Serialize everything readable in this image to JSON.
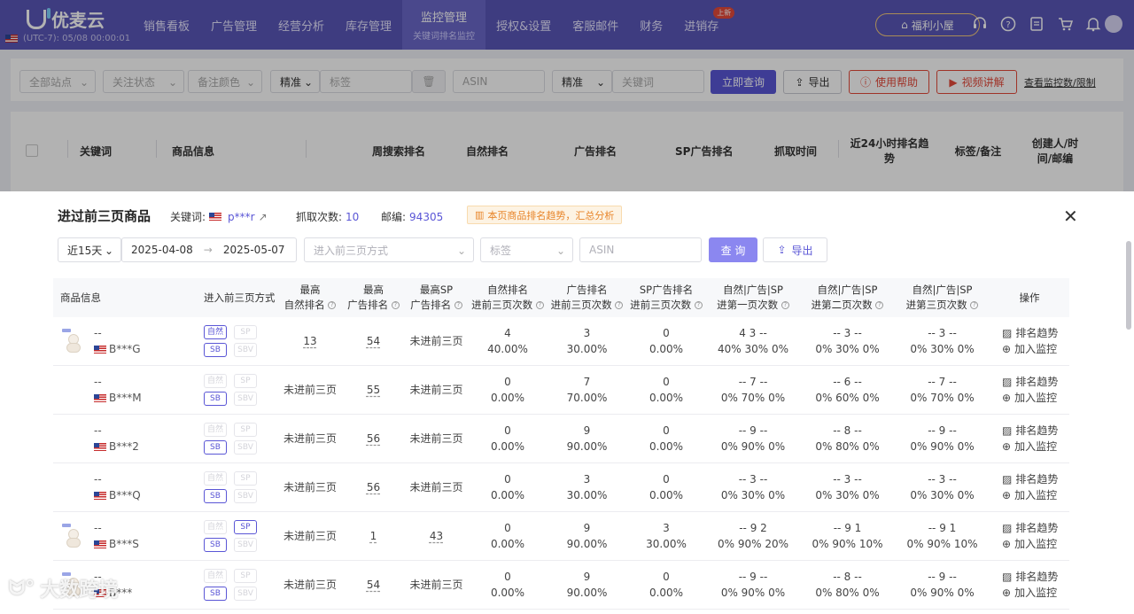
{
  "header": {
    "logo": "优麦云",
    "tz": "(UTC-7): 05/08 00:00:01",
    "nav": [
      {
        "label": "销售看板"
      },
      {
        "label": "广告管理"
      },
      {
        "label": "经营分析"
      },
      {
        "label": "库存管理"
      },
      {
        "label": "监控管理",
        "sub": "关键词排名监控",
        "active": true
      },
      {
        "label": "授权&设置"
      },
      {
        "label": "客服邮件"
      },
      {
        "label": "财务"
      },
      {
        "label": "进销存",
        "badge": "上新"
      }
    ],
    "fuli": "福利小屋",
    "icons": [
      "headset-icon",
      "help-icon",
      "doc-icon",
      "cart-icon",
      "bell-icon",
      "avatar"
    ]
  },
  "filters": {
    "site": "全部站点",
    "follow": "关注状态",
    "color": "备注颜色",
    "precise1": "精准",
    "tag": "标签",
    "asin": "ASIN",
    "precise2": "精准",
    "keyword": "关键词",
    "query": "立即查询",
    "export": "导出",
    "help": "使用帮助",
    "video": "视频讲解",
    "link": "查看监控数/限制"
  },
  "main_table": {
    "headers": [
      "关键词",
      "商品信息",
      "周搜索排名",
      "自然排名",
      "广告排名",
      "SP广告排名",
      "抓取时间",
      "近24小时排名趋势",
      "标签/备注",
      "创建人/时间/邮编"
    ]
  },
  "modal": {
    "title": "进过前三页商品",
    "kw_label": "关键词:",
    "kw_value": "p***r",
    "count_label": "抓取次数:",
    "count_value": "10",
    "zip_label": "邮编:",
    "zip_value": "94305",
    "hint": "本页商品排名趋势，汇总分析",
    "range": "近15天",
    "date_from": "2025-04-08",
    "date_to": "2025-05-07",
    "method_placeholder": "进入前三页方式",
    "tag_placeholder": "标签",
    "asin_placeholder": "ASIN",
    "query": "查 询",
    "export": "导出"
  },
  "table": {
    "headers": {
      "product": "商品信息",
      "method": "进入前三页方式",
      "best_nat_1": "最高",
      "best_nat_2": "自然排名",
      "best_ad_1": "最高",
      "best_ad_2": "广告排名",
      "best_sp_1": "最高SP",
      "best_sp_2": "广告排名",
      "nat_cnt_1": "自然排名",
      "nat_cnt_2": "进前三页次数",
      "ad_cnt_1": "广告排名",
      "ad_cnt_2": "进前三页次数",
      "sp_cnt_1": "SP广告排名",
      "sp_cnt_2": "进前三页次数",
      "p1_1": "自然|广告|SP",
      "p1_2": "进第一页次数",
      "p2_1": "自然|广告|SP",
      "p2_2": "进第二页次数",
      "p3_1": "自然|广告|SP",
      "p3_2": "进第三页次数",
      "op": "操作"
    },
    "tag_labels": [
      "自然",
      "SP",
      "SB",
      "SBV"
    ],
    "op_trend": "排名趋势",
    "op_add": "加入监控",
    "rows": [
      {
        "name": "--",
        "asin": "B***G",
        "thumb": true,
        "tags": [
          true,
          false,
          true,
          false
        ],
        "best_nat": "13",
        "best_ad": "54",
        "best_sp": "未进前三页",
        "nat_cnt": "4",
        "nat_pct": "40.00%",
        "ad_cnt": "3",
        "ad_pct": "30.00%",
        "sp_cnt": "0",
        "sp_pct": "0.00%",
        "p1": "4 3 --",
        "p1p": "40% 30% 0%",
        "p2": "-- 3 --",
        "p2p": "0% 30% 0%",
        "p3": "-- 3 --",
        "p3p": "0% 30% 0%"
      },
      {
        "name": "--",
        "asin": "B***M",
        "thumb": false,
        "tags": [
          false,
          false,
          true,
          false
        ],
        "best_nat": "未进前三页",
        "best_ad": "55",
        "best_sp": "未进前三页",
        "nat_cnt": "0",
        "nat_pct": "0.00%",
        "ad_cnt": "7",
        "ad_pct": "70.00%",
        "sp_cnt": "0",
        "sp_pct": "0.00%",
        "p1": "-- 7 --",
        "p1p": "0% 70% 0%",
        "p2": "-- 6 --",
        "p2p": "0% 60% 0%",
        "p3": "-- 7 --",
        "p3p": "0% 70% 0%"
      },
      {
        "name": "--",
        "asin": "B***2",
        "thumb": false,
        "tags": [
          false,
          false,
          true,
          false
        ],
        "best_nat": "未进前三页",
        "best_ad": "56",
        "best_sp": "未进前三页",
        "nat_cnt": "0",
        "nat_pct": "0.00%",
        "ad_cnt": "9",
        "ad_pct": "90.00%",
        "sp_cnt": "0",
        "sp_pct": "0.00%",
        "p1": "-- 9 --",
        "p1p": "0% 90% 0%",
        "p2": "-- 8 --",
        "p2p": "0% 80% 0%",
        "p3": "-- 9 --",
        "p3p": "0% 90% 0%"
      },
      {
        "name": "--",
        "asin": "B***Q",
        "thumb": false,
        "tags": [
          false,
          false,
          true,
          false
        ],
        "best_nat": "未进前三页",
        "best_ad": "56",
        "best_sp": "未进前三页",
        "nat_cnt": "0",
        "nat_pct": "0.00%",
        "ad_cnt": "3",
        "ad_pct": "30.00%",
        "sp_cnt": "0",
        "sp_pct": "0.00%",
        "p1": "-- 3 --",
        "p1p": "0% 30% 0%",
        "p2": "-- 3 --",
        "p2p": "0% 30% 0%",
        "p3": "-- 3 --",
        "p3p": "0% 30% 0%"
      },
      {
        "name": "--",
        "asin": "B***S",
        "thumb": true,
        "tags": [
          false,
          true,
          true,
          false
        ],
        "best_nat": "未进前三页",
        "best_ad": "1",
        "best_sp": "43",
        "nat_cnt": "0",
        "nat_pct": "0.00%",
        "ad_cnt": "9",
        "ad_pct": "90.00%",
        "sp_cnt": "3",
        "sp_pct": "30.00%",
        "p1": "-- 9 2",
        "p1p": "0% 90% 20%",
        "p2": "-- 9 1",
        "p2p": "0% 90% 10%",
        "p3": "-- 9 1",
        "p3p": "0% 90% 10%"
      },
      {
        "name": "--",
        "asin": "B***",
        "thumb": true,
        "tags": [
          false,
          false,
          true,
          false
        ],
        "best_nat": "未进前三页",
        "best_ad": "54",
        "best_sp": "未进前三页",
        "nat_cnt": "0",
        "nat_pct": "0.00%",
        "ad_cnt": "9",
        "ad_pct": "90.00%",
        "sp_cnt": "0",
        "sp_pct": "0.00%",
        "p1": "-- 9 --",
        "p1p": "0% 90% 0%",
        "p2": "-- 8 --",
        "p2p": "0% 80% 0%",
        "p3": "-- 9 --",
        "p3p": "0% 90% 0%"
      }
    ]
  },
  "watermark": "大数跨境"
}
